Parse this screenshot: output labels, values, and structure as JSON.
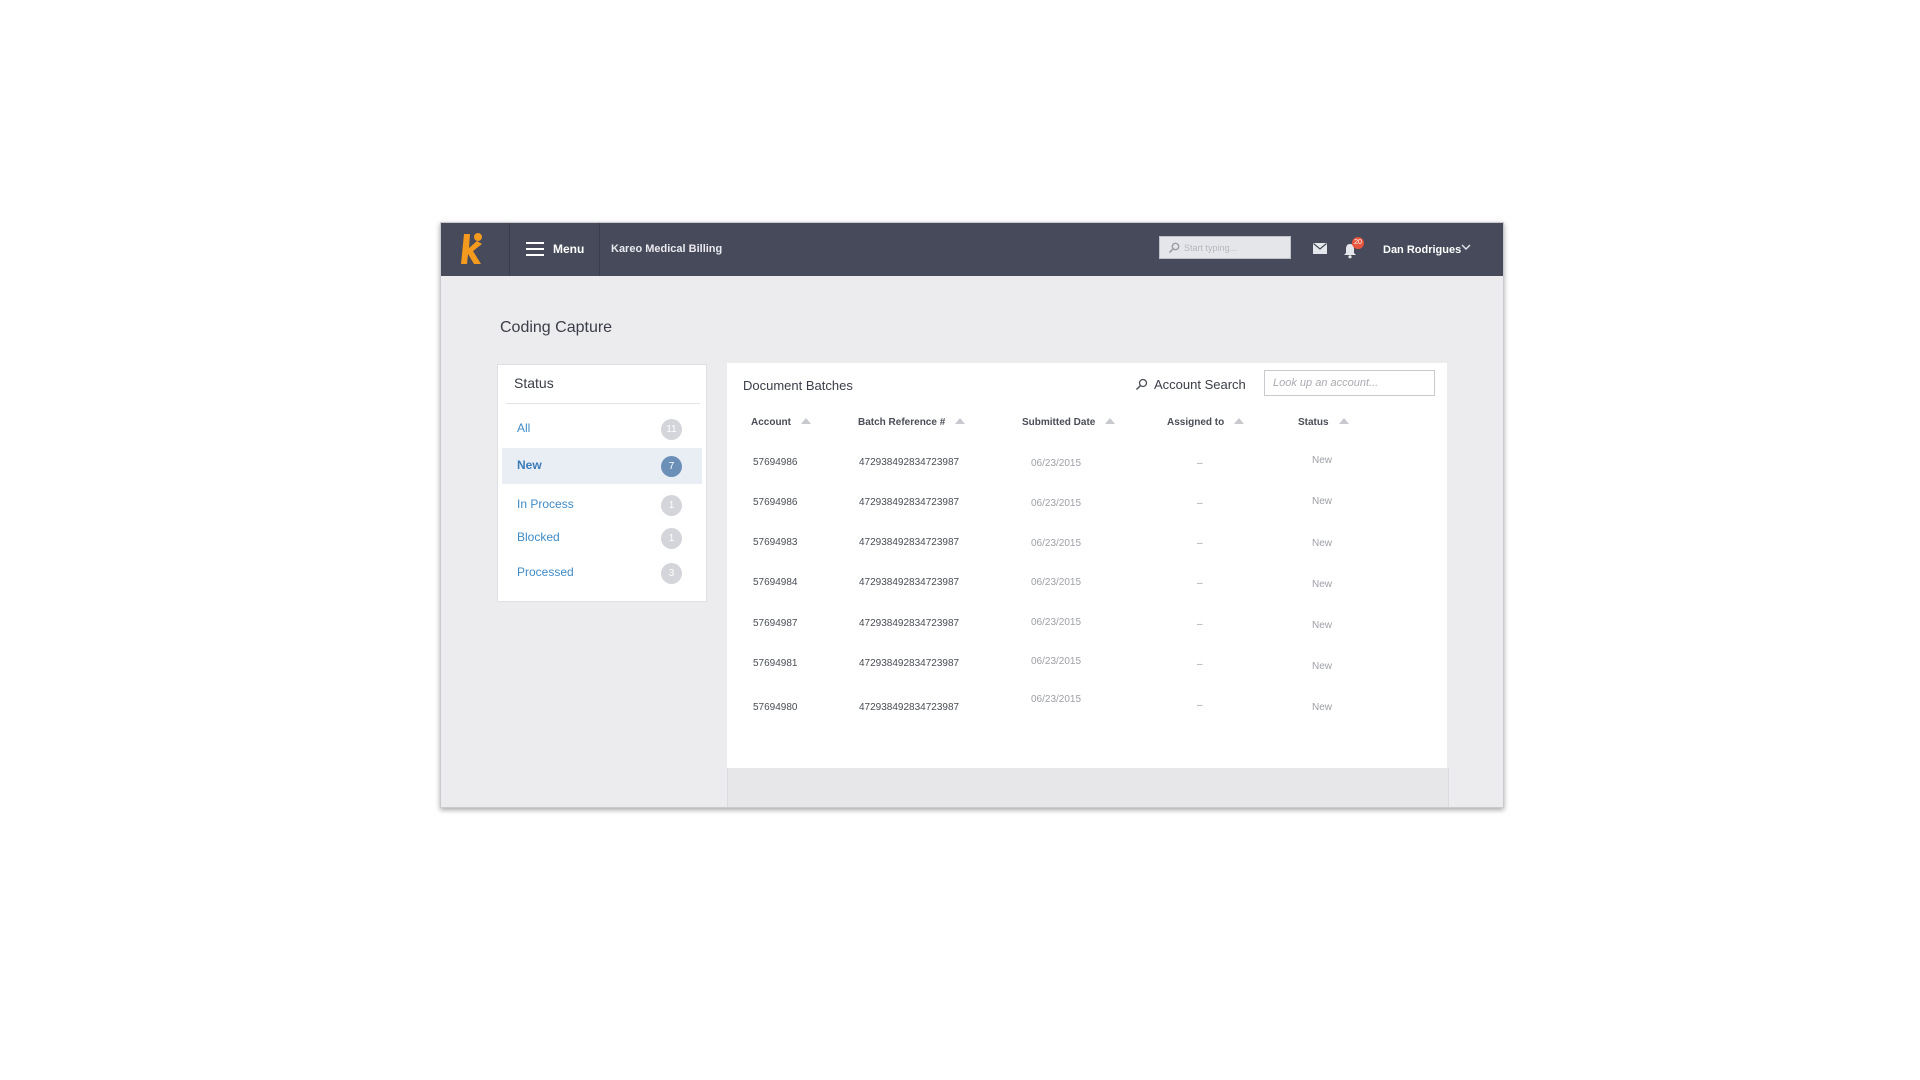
{
  "topbar": {
    "menu_label": "Menu",
    "app_title": "Kareo Medical Billing",
    "search_placeholder": "Start typing...",
    "notifications_count": "20",
    "user_name": "Dan Rodrigues"
  },
  "page": {
    "title": "Coding Capture"
  },
  "status_panel": {
    "heading": "Status",
    "items": [
      {
        "label": "All",
        "count": "11"
      },
      {
        "label": "New",
        "count": "7"
      },
      {
        "label": "In Process",
        "count": "1"
      },
      {
        "label": "Blocked",
        "count": "1"
      },
      {
        "label": "Processed",
        "count": "3"
      }
    ]
  },
  "documents": {
    "heading": "Document Batches",
    "account_search_label": "Account Search",
    "account_search_placeholder": "Look up an account...",
    "columns": [
      "Account",
      "Batch Reference #",
      "Submitted Date",
      "Assigned to",
      "Status"
    ],
    "rows": [
      {
        "account": "57694986",
        "batch": "472938492834723987",
        "date": "06/23/2015",
        "assigned": "–",
        "status": "New"
      },
      {
        "account": "57694986",
        "batch": "472938492834723987",
        "date": "06/23/2015",
        "assigned": "–",
        "status": "New"
      },
      {
        "account": "57694983",
        "batch": "472938492834723987",
        "date": "06/23/2015",
        "assigned": "–",
        "status": "New"
      },
      {
        "account": "57694984",
        "batch": "472938492834723987",
        "date": "06/23/2015",
        "assigned": "–",
        "status": "New"
      },
      {
        "account": "57694987",
        "batch": "472938492834723987",
        "date": "06/23/2015",
        "assigned": "–",
        "status": "New"
      },
      {
        "account": "57694981",
        "batch": "472938492834723987",
        "date": "06/23/2015",
        "assigned": "–",
        "status": "New"
      },
      {
        "account": "57694980",
        "batch": "472938492834723987",
        "date": "06/23/2015",
        "assigned": "–",
        "status": "New"
      }
    ]
  },
  "colors": {
    "topbar": "#464a5a",
    "logo_orange": "#f39a1f",
    "link_blue": "#3f8bc7",
    "active_badge": "#6c8fb8",
    "notification_badge": "#e8553d"
  },
  "icons": [
    "kareo-logo-icon",
    "hamburger-icon",
    "search-icon",
    "mail-icon",
    "bell-icon",
    "chevron-down-icon",
    "sort-arrow-icon"
  ]
}
